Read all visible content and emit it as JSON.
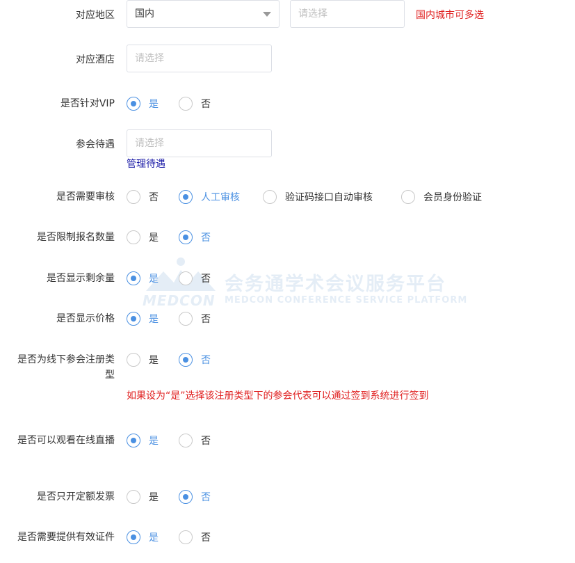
{
  "fields": {
    "region": {
      "label": "对应地区",
      "select_value": "国内",
      "city_placeholder": "请选择",
      "note": "国内城市可多选"
    },
    "hotel": {
      "label": "对应酒店",
      "placeholder": "请选择"
    },
    "vip": {
      "label": "是否针对VIP",
      "options": [
        "是",
        "否"
      ],
      "selected": "是"
    },
    "treatment": {
      "label": "参会待遇",
      "placeholder": "请选择",
      "link": "管理待遇"
    },
    "review": {
      "label": "是否需要审核",
      "options": [
        "否",
        "人工审核",
        "验证码接口自动审核",
        "会员身份验证"
      ],
      "selected": "人工审核"
    },
    "limit": {
      "label": "是否限制报名数量",
      "options": [
        "是",
        "否"
      ],
      "selected": "否"
    },
    "remaining": {
      "label": "是否显示剩余量",
      "options": [
        "是",
        "否"
      ],
      "selected": "是"
    },
    "price": {
      "label": "是否显示价格",
      "options": [
        "是",
        "否"
      ],
      "selected": "是"
    },
    "offline": {
      "label": "是否为线下参会注册类型",
      "options": [
        "是",
        "否"
      ],
      "selected": "否",
      "note": "如果设为“是”选择该注册类型下的参会代表可以通过签到系统进行签到"
    },
    "live": {
      "label": "是否可以观看在线直播",
      "options": [
        "是",
        "否"
      ],
      "selected": "是"
    },
    "invoice": {
      "label": "是否只开定额发票",
      "options": [
        "是",
        "否"
      ],
      "selected": "否"
    },
    "certificate": {
      "label": "是否需要提供有效证件",
      "options": [
        "是",
        "否"
      ],
      "selected": "是"
    }
  },
  "watermark": {
    "logo": "MEDCON",
    "title": "会务通学术会议服务平台",
    "subtitle": "MEDCON CONFERENCE SERVICE PLATFORM"
  },
  "colors": {
    "accent": "#4a90e2",
    "note_red": "#e02020",
    "link": "#1a1aa6"
  }
}
